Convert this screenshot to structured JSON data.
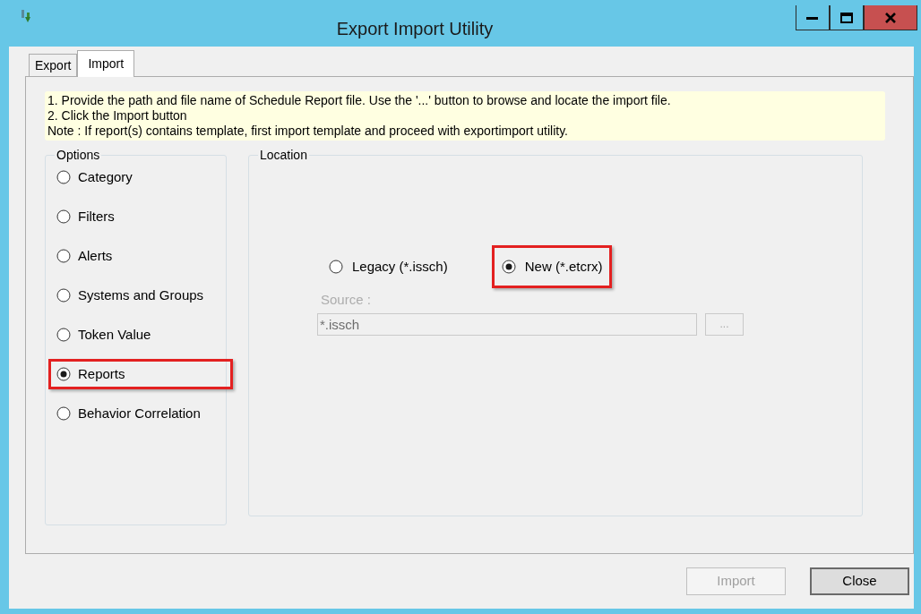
{
  "window": {
    "title": "Export Import Utility",
    "controls": [
      {
        "kind": "minimize"
      },
      {
        "kind": "maximize"
      },
      {
        "kind": "close"
      }
    ]
  },
  "tabs": [
    {
      "label": "Export",
      "selected": false
    },
    {
      "label": "Import",
      "selected": true
    }
  ],
  "instructions": [
    "1. Provide the path and file name of Schedule Report file. Use the '...' button to browse and locate the import file.",
    "2. Click the Import button",
    "Note : If report(s) contains template, first import template and proceed with exportimport utility."
  ],
  "options": {
    "title": "Options",
    "items": [
      {
        "label": "Category",
        "selected": false,
        "highlighted": false
      },
      {
        "label": "Filters",
        "selected": false,
        "highlighted": false
      },
      {
        "label": "Alerts",
        "selected": false,
        "highlighted": false
      },
      {
        "label": "Systems and Groups",
        "selected": false,
        "highlighted": false
      },
      {
        "label": "Token Value",
        "selected": false,
        "highlighted": false
      },
      {
        "label": "Reports",
        "selected": true,
        "highlighted": true
      },
      {
        "label": "Behavior Correlation",
        "selected": false,
        "highlighted": false
      }
    ]
  },
  "location": {
    "title": "Location",
    "formats": [
      {
        "label": "Legacy (*.issch)",
        "selected": false,
        "highlighted": false
      },
      {
        "label": "New (*.etcrx)",
        "selected": true,
        "highlighted": true
      }
    ],
    "source": {
      "label": "Source :",
      "value": "*.issch",
      "disabled": true,
      "browse_label": "..."
    }
  },
  "buttons": [
    {
      "label": "Import",
      "disabled": true,
      "default": false
    },
    {
      "label": "Close",
      "disabled": false,
      "default": true
    }
  ]
}
